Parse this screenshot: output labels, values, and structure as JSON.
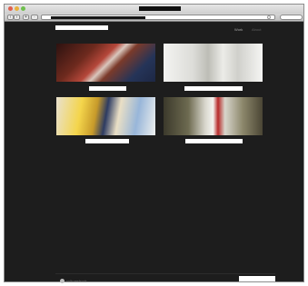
{
  "nav": {
    "link_1": "Work",
    "link_2": "About"
  },
  "footer": {
    "text": "cultureshock"
  },
  "toolbar": {
    "back": "‹",
    "forward": "›",
    "add": "+",
    "rss": "·"
  },
  "gallery": {
    "items": [
      {
        "icon": "image-thumbnail"
      },
      {
        "icon": "image-thumbnail"
      },
      {
        "icon": "image-thumbnail"
      },
      {
        "icon": "image-thumbnail"
      }
    ]
  }
}
